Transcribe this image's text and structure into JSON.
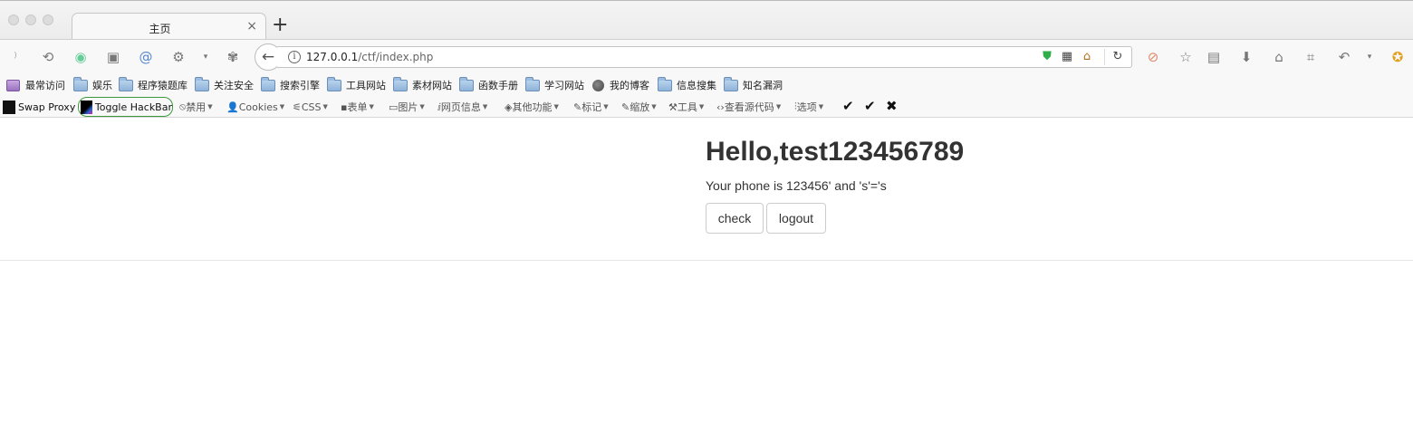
{
  "tab": {
    "title": "主页",
    "close": "×",
    "new_tab": "+"
  },
  "nav": {
    "url_host": "127.0.0.1",
    "url_path": "/ctf/index.php",
    "left_icons": [
      "rss-icon",
      "history-icon",
      "color-icon",
      "reader-icon",
      "snail-icon",
      "gear-icon",
      "dropdown-icon",
      "palette-icon"
    ],
    "right_icons": [
      "blocked-icon",
      "star-icon",
      "reading-list-icon",
      "download-icon",
      "home-icon",
      "crop-icon",
      "undo-icon",
      "dropdown-icon",
      "extension-icon"
    ]
  },
  "bookmarks": [
    {
      "label": "最常访问",
      "icon": "smart-folder-icon"
    },
    {
      "label": "娱乐",
      "icon": "folder-icon"
    },
    {
      "label": "程序猿题库",
      "icon": "folder-icon"
    },
    {
      "label": "关注安全",
      "icon": "folder-icon"
    },
    {
      "label": "搜索引擎",
      "icon": "folder-icon"
    },
    {
      "label": "工具网站",
      "icon": "folder-icon"
    },
    {
      "label": "素材网站",
      "icon": "folder-icon"
    },
    {
      "label": "函数手册",
      "icon": "folder-icon"
    },
    {
      "label": "学习网站",
      "icon": "folder-icon"
    },
    {
      "label": "我的博客",
      "icon": "globe-icon"
    },
    {
      "label": "信息搜集",
      "icon": "folder-icon"
    },
    {
      "label": "知名漏洞",
      "icon": "folder-icon"
    }
  ],
  "toolbar": {
    "swap_proxy": "Swap Proxy",
    "toggle_hackbar": "Toggle HackBar",
    "menus": [
      "禁用",
      "Cookies",
      "CSS",
      "表单",
      "图片",
      "网页信息",
      "其他功能",
      "标记",
      "缩放",
      "工具",
      "查看源代码",
      "选项"
    ]
  },
  "page": {
    "greeting": "Hello,test123456789",
    "phone_line": "Your phone is 123456' and 's'='s",
    "check_label": "check",
    "logout_label": "logout"
  },
  "colors": {
    "hackbar_border": "#3a9a3a",
    "shield_green": "#2fae4a"
  }
}
